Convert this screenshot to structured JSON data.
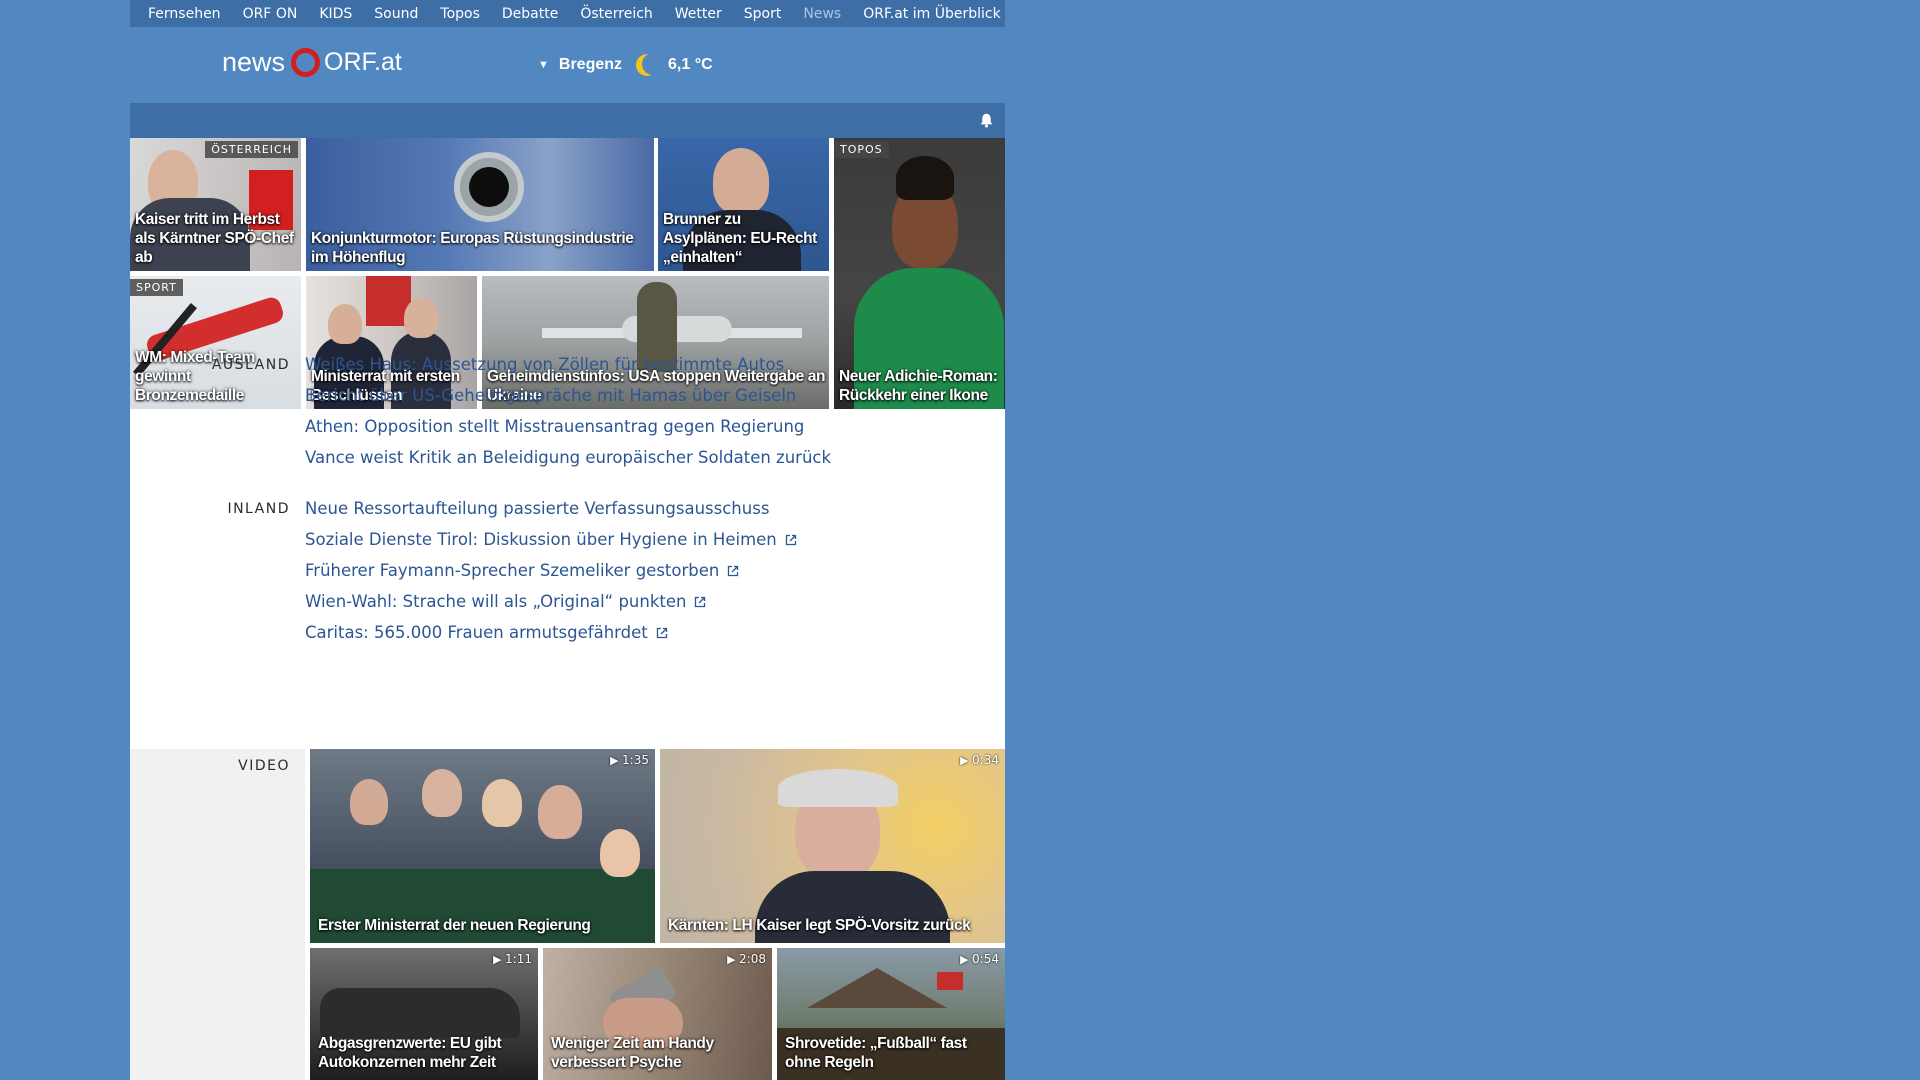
{
  "topnav": {
    "items": [
      "Fernsehen",
      "ORF ON",
      "KIDS",
      "Sound",
      "Topos",
      "Debatte",
      "Österreich",
      "Wetter",
      "Sport",
      "News"
    ],
    "active": "News",
    "overview": "ORF.at im Überblick"
  },
  "header": {
    "logo_news": "news",
    "logo_orf": "ORF.at",
    "weather_location": "Bregenz",
    "weather_temp": "6,1 °C",
    "weather_icon": "moon-icon"
  },
  "top_teasers": [
    {
      "title": "Kaiser tritt im Herbst als Kärntner SPÖ-Chef ab",
      "badge": "ÖSTERREICH"
    },
    {
      "title": "Konjunkturmotor: Europas Rüstungsindustrie im Höhenflug",
      "badge": ""
    },
    {
      "title": "Brunner zu Asylplänen: EU-Recht „einhalten“",
      "badge": ""
    },
    {
      "title": "Neuer Adichie-Roman: Rückkehr einer Ikone",
      "badge": "TOPOS"
    },
    {
      "title": "WM: Mixed-Team gewinnt Bronzemedaille",
      "badge": "SPORT"
    },
    {
      "title": "Ministerrat mit ersten Beschlüssen",
      "badge": ""
    },
    {
      "title": "Geheimdienstinfos: USA stoppen Weitergabe an Ukraine",
      "badge": ""
    }
  ],
  "ausland": {
    "label": "AUSLAND",
    "headlines": [
      "Weißes Haus: Aussetzung von Zöllen für bestimmte Autos",
      "Bericht über US-Geheimgespräche mit Hamas über Geiseln",
      "Athen: Opposition stellt Misstrauensantrag gegen Regierung",
      "Vance weist Kritik an Beleidigung europäischer Soldaten zurück"
    ]
  },
  "inland": {
    "label": "INLAND",
    "headlines": [
      {
        "text": "Neue Ressortaufteilung passierte Verfassungsausschuss",
        "external": false
      },
      {
        "text": "Soziale Dienste Tirol: Diskussion über Hygiene in Heimen",
        "external": true
      },
      {
        "text": "Früherer Faymann-Sprecher Szemeliker gestorben",
        "external": true
      },
      {
        "text": "Wien-Wahl: Strache will als „Original“ punkten",
        "external": true
      },
      {
        "text": "Caritas: 565.000 Frauen armutsgefährdet",
        "external": true
      }
    ]
  },
  "video": {
    "label": "VIDEO",
    "items": [
      {
        "title": "Erster Ministerrat der neuen Regierung",
        "duration": "1:35"
      },
      {
        "title": "Kärnten: LH Kaiser legt SPÖ-Vorsitz zurück",
        "duration": "0:34"
      },
      {
        "title": "Abgasgrenzwerte: EU gibt Autokonzernen mehr Zeit",
        "duration": "1:11"
      },
      {
        "title": "Weniger Zeit am Handy verbessert Psyche",
        "duration": "2:08"
      },
      {
        "title": "Shrovetide: „Fußball“ fast ohne Regeln",
        "duration": "0:54"
      }
    ]
  },
  "colors": {
    "page_bg": "#5288c2",
    "nav_bg": "#3e6ea6",
    "headline": "#2b5693",
    "orf_red": "#d51d1d"
  }
}
